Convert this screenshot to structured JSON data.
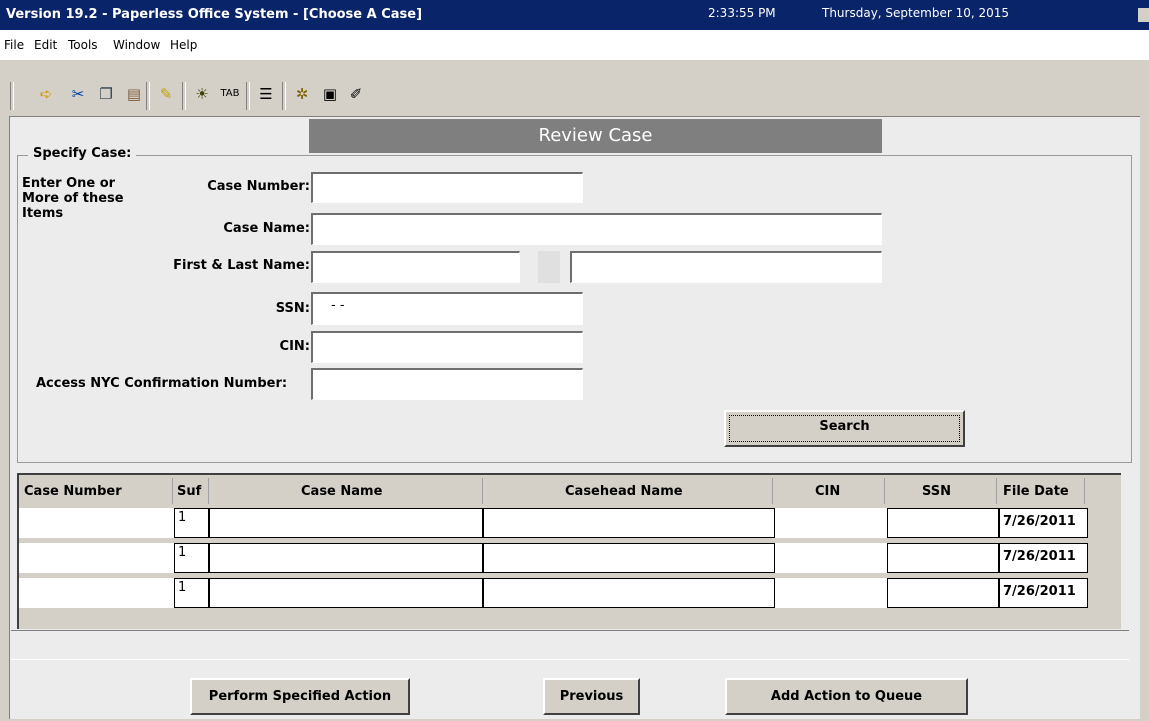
{
  "window": {
    "title": "Version 19.2 - Paperless Office System - [Choose A Case]",
    "time": "2:33:55 PM",
    "date": "Thursday, September 10, 2015"
  },
  "menu": [
    "File",
    "Edit",
    "Tools",
    "Window",
    "Help"
  ],
  "toolbar_icons": [
    "back-arrow-icon",
    "scissors-icon",
    "copy-icon",
    "paste-icon",
    "eraser-icon",
    "bulb-icon",
    "tab-icon",
    "list-icon",
    "gear-icon",
    "book-icon",
    "notepad-icon"
  ],
  "banner": "Review Case",
  "specify": {
    "legend": "Specify Case:",
    "hint": "Enter One or More of these Items",
    "case_number_label": "Case Number:",
    "case_name_label": "Case Name:",
    "first_last_label": "First & Last Name:",
    "ssn_label": "SSN:",
    "ssn_value": "- -",
    "cin_label": "CIN:",
    "access_label": "Access NYC Confirmation Number:",
    "search_label": "Search"
  },
  "table": {
    "columns": [
      "Case Number",
      "Suf",
      "Case Name",
      "Casehead Name",
      "CIN",
      "SSN",
      "File Date"
    ],
    "rows": [
      {
        "suf": "1",
        "file_date": "7/26/2011"
      },
      {
        "suf": "1",
        "file_date": "7/26/2011"
      },
      {
        "suf": "1",
        "file_date": "7/26/2011"
      }
    ]
  },
  "actions": {
    "perform": "Perform Specified Action",
    "previous": "Previous",
    "add_queue": "Add Action to Queue"
  },
  "colors": {
    "titlebar": "#0a246a",
    "banner": "#7f7f7f",
    "panel": "#ececec",
    "chrome": "#d4d0c8"
  }
}
